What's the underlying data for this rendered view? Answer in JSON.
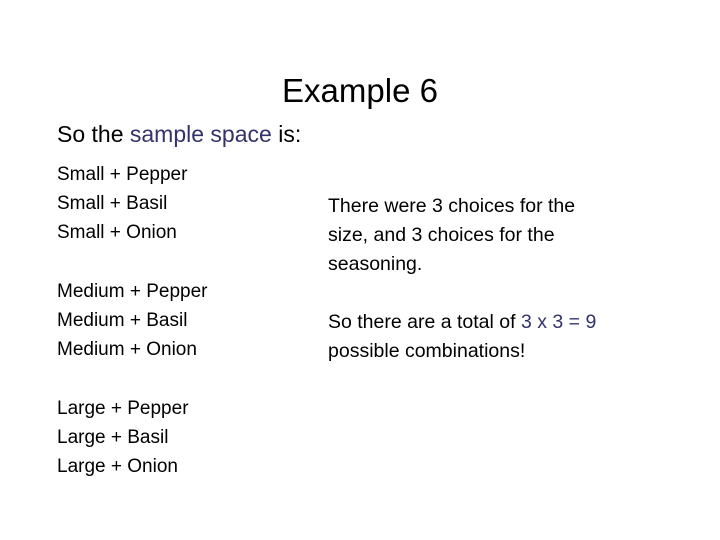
{
  "slide": {
    "title": "Example 6",
    "subtitle": {
      "lead": "So the ",
      "highlight": "sample space",
      "trail": " is:"
    },
    "accent_color": "#33336b",
    "text_color": "#000000",
    "background_color": "#ffffff"
  },
  "sample_space": {
    "groups": [
      {
        "size": "Small",
        "items": [
          "Small + Pepper",
          "Small + Basil",
          "Small + Onion"
        ]
      },
      {
        "size": "Medium",
        "items": [
          "Medium + Pepper",
          "Medium + Basil",
          "Medium + Onion"
        ]
      },
      {
        "size": "Large",
        "items": [
          "Large + Pepper",
          "Large + Basil",
          "Large + Onion"
        ]
      }
    ]
  },
  "notes": {
    "first": {
      "line1": "There were 3 choices for the",
      "line2": "size, and 3 choices for the",
      "line3": "seasoning."
    },
    "second": {
      "lead": "So there are a total of ",
      "highlight": "3 x 3 = 9",
      "line2": "possible combinations!"
    }
  }
}
